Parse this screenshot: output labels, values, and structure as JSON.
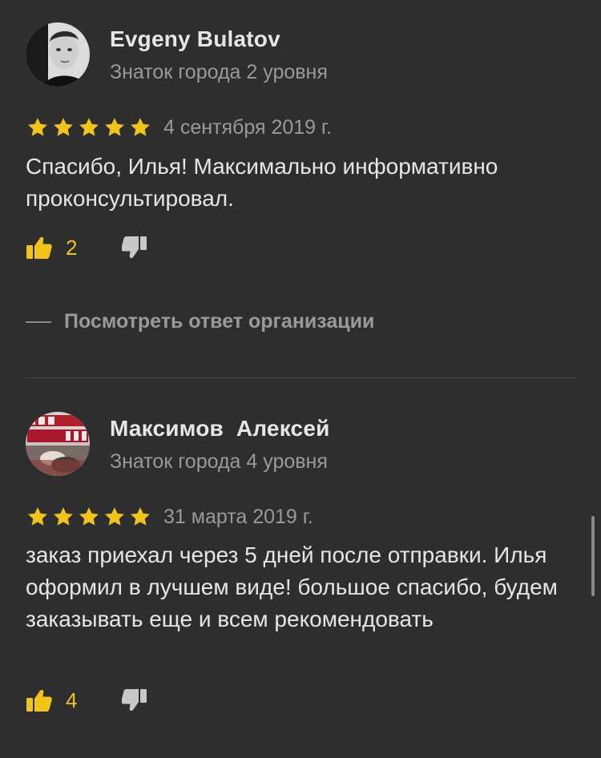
{
  "colors": {
    "background": "#2e2e2e",
    "star": "#f0c419",
    "primary_text": "#e6e6e6",
    "secondary_text": "#9a9a9a",
    "like_icon": "#f0c419",
    "dislike_icon": "#c8c8c8"
  },
  "reviews": [
    {
      "author": "Evgeny Bulatov",
      "level": "Знаток города 2 уровня",
      "rating": 5,
      "date": "4 сентября 2019 г.",
      "text": "Спасибо, Илья! Максимально информативно проконсультировал.",
      "likes": "2",
      "answer_link": "Посмотреть ответ организации",
      "icons": {
        "like": "thumbs-up-icon",
        "dislike": "thumbs-down-icon",
        "star": "star-icon"
      }
    },
    {
      "author": "Максимов  Алексей",
      "level": "Знаток города 4 уровня",
      "rating": 5,
      "date": "31 марта 2019 г.",
      "text": "заказ приехал через 5 дней после отправки. Илья оформил в лучшем виде! большое спасибо, будем заказывать еще и всем рекомендовать",
      "likes": "4",
      "icons": {
        "like": "thumbs-up-icon",
        "dislike": "thumbs-down-icon",
        "star": "star-icon"
      }
    }
  ]
}
